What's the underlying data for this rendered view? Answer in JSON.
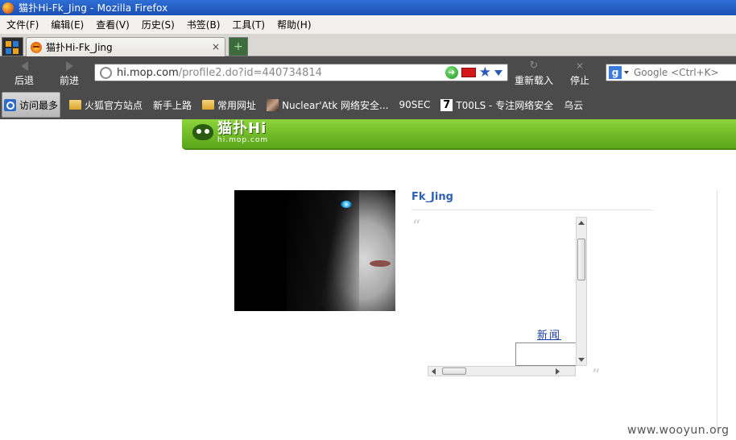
{
  "window": {
    "title": "猫扑Hi-Fk_Jing - Mozilla Firefox"
  },
  "menu": {
    "items": [
      "文件(F)",
      "编辑(E)",
      "查看(V)",
      "历史(S)",
      "书签(B)",
      "工具(T)",
      "帮助(H)"
    ]
  },
  "tabs": {
    "active_label": "猫扑Hi-Fk_Jing",
    "close_glyph": "×",
    "new_tab_glyph": "+"
  },
  "nav": {
    "back_label": "后退",
    "forward_label": "前进",
    "url_host": "hi.mop.com",
    "url_path": "/profile2.do?id=440734814",
    "reload_label": "重新载入",
    "stop_label": "停止",
    "search_placeholder": "Google <Ctrl+K>"
  },
  "bookmarks": {
    "items": [
      {
        "label": "访问最多",
        "icon": "search-icon"
      },
      {
        "label": "火狐官方站点",
        "icon": "folder-icon"
      },
      {
        "label": "新手上路",
        "icon": "page-icon"
      },
      {
        "label": "常用网址",
        "icon": "folder-icon"
      },
      {
        "label": "Nuclear'Atk 网络安全...",
        "icon": "image-icon"
      },
      {
        "label": "90SEC",
        "icon": "page-icon"
      },
      {
        "label": "T00LS - 专注网络安全",
        "icon": "seven-icon"
      },
      {
        "label": "乌云",
        "icon": "page-icon"
      }
    ]
  },
  "site": {
    "logo_text": "猫扑Hi",
    "logo_domain": "hi.mop.com",
    "accent_color": "#6ab82a"
  },
  "profile": {
    "username": "Fk_Jing",
    "quote_open": "“",
    "quote_close": "”",
    "news_link": "新闻"
  },
  "watermark": "www.wooyun.org"
}
